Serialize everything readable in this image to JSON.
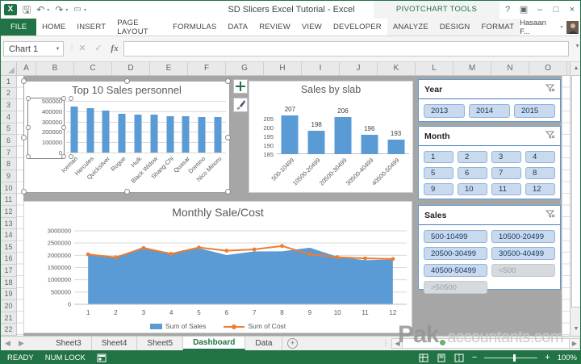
{
  "window": {
    "title": "SD Slicers Excel Tutorial - Excel",
    "contextual_title": "PIVOTCHART TOOLS",
    "controls": {
      "help": "?",
      "ribbon_display": "▣",
      "minimize": "–",
      "maximize": "□",
      "close": "×"
    }
  },
  "qat_icons": [
    "excel-logo",
    "save-icon",
    "undo-icon",
    "redo-icon",
    "touch-mode-icon",
    "customize-qat-icon"
  ],
  "ribbon": {
    "file_label": "FILE",
    "tabs": [
      "HOME",
      "INSERT",
      "PAGE LAYOUT",
      "FORMULAS",
      "DATA",
      "REVIEW",
      "VIEW",
      "DEVELOPER"
    ],
    "contextual_tabs": [
      "ANALYZE",
      "DESIGN",
      "FORMAT"
    ],
    "user_name": "Hasaan F..."
  },
  "formula_bar": {
    "name_box": "Chart 1",
    "formula": ""
  },
  "grid": {
    "columns": [
      "A",
      "B",
      "C",
      "D",
      "E",
      "F",
      "G",
      "H",
      "I",
      "J",
      "K",
      "L",
      "M",
      "N",
      "O"
    ],
    "rows": [
      "1",
      "2",
      "3",
      "4",
      "5",
      "6",
      "7",
      "8",
      "9",
      "10",
      "11",
      "12",
      "13",
      "14",
      "15",
      "16",
      "17",
      "18",
      "19",
      "20",
      "21",
      "22"
    ]
  },
  "chart_data": [
    {
      "type": "bar",
      "title": "Top 10 Sales personnel",
      "categories": [
        "Iceman",
        "Hercules",
        "Quicksilver",
        "Rogue",
        "Hulk",
        "Black Widow",
        "Shang-Chi",
        "Quasar",
        "Domino",
        "Nico Minoru"
      ],
      "values": [
        445000,
        433000,
        407000,
        372000,
        371000,
        370000,
        355000,
        353000,
        347000,
        346000
      ],
      "ylim": [
        0,
        500000
      ],
      "yticks": [
        0,
        100000,
        200000,
        300000,
        400000,
        500000
      ],
      "bar_color": "#5b9bd5",
      "grid": true,
      "selected": true
    },
    {
      "type": "bar",
      "title": "Sales by slab",
      "categories": [
        "500-10499",
        "10500-20499",
        "20500-30499",
        "30500-40499",
        "40500-50499"
      ],
      "values": [
        207,
        198,
        206,
        196,
        193
      ],
      "data_labels": [
        207,
        198,
        206,
        196,
        193
      ],
      "ylim": [
        185,
        210
      ],
      "yticks": [
        185,
        190,
        195,
        200,
        205
      ],
      "bar_color": "#5b9bd5",
      "grid": false
    },
    {
      "type": "area-line",
      "title": "Monthly Sale/Cost",
      "x": [
        1,
        2,
        3,
        4,
        5,
        6,
        7,
        8,
        9,
        10,
        11,
        12
      ],
      "series": [
        {
          "name": "Sum of Sales",
          "type": "area",
          "color": "#5b9bd5",
          "values": [
            2010000,
            1915000,
            2345000,
            2040000,
            2290000,
            2010000,
            2160000,
            2165000,
            2310000,
            1940000,
            1800000,
            1830000
          ]
        },
        {
          "name": "Sum of Cost",
          "type": "line",
          "color": "#ed7d31",
          "values": [
            2040000,
            1915000,
            2300000,
            2060000,
            2320000,
            2190000,
            2240000,
            2380000,
            2040000,
            1925000,
            1875000,
            1850000
          ]
        }
      ],
      "ylim": [
        0,
        3000000
      ],
      "yticks": [
        0,
        500000,
        1000000,
        1500000,
        2000000,
        2500000,
        3000000
      ],
      "legend": "bottom"
    }
  ],
  "chart_buttons": [
    "add-chart-element",
    "chart-styles"
  ],
  "slicers": [
    {
      "title": "Year",
      "columns": 3,
      "items": [
        {
          "label": "2013",
          "state": "selected"
        },
        {
          "label": "2014",
          "state": "selected"
        },
        {
          "label": "2015",
          "state": "selected"
        }
      ]
    },
    {
      "title": "Month",
      "columns": 4,
      "items": [
        {
          "label": "1",
          "state": "selected"
        },
        {
          "label": "2",
          "state": "selected"
        },
        {
          "label": "3",
          "state": "selected"
        },
        {
          "label": "4",
          "state": "selected"
        },
        {
          "label": "5",
          "state": "selected"
        },
        {
          "label": "6",
          "state": "selected"
        },
        {
          "label": "7",
          "state": "selected"
        },
        {
          "label": "8",
          "state": "selected"
        },
        {
          "label": "9",
          "state": "selected"
        },
        {
          "label": "10",
          "state": "selected"
        },
        {
          "label": "11",
          "state": "selected"
        },
        {
          "label": "12",
          "state": "selected"
        }
      ]
    },
    {
      "title": "Sales",
      "columns": 2,
      "items": [
        {
          "label": "500-10499",
          "state": "selected"
        },
        {
          "label": "10500-20499",
          "state": "selected"
        },
        {
          "label": "20500-30499",
          "state": "selected"
        },
        {
          "label": "30500-40499",
          "state": "selected"
        },
        {
          "label": "40500-50499",
          "state": "selected"
        },
        {
          "label": "<500",
          "state": "nodata"
        },
        {
          "label": ">50500",
          "state": "nodata"
        }
      ]
    }
  ],
  "sheet_tabs": {
    "tabs": [
      "Sheet3",
      "Sheet4",
      "Sheet5",
      "Dashboard",
      "Data"
    ],
    "active": "Dashboard"
  },
  "status_bar": {
    "mode": "READY",
    "numlock": "NUM LOCK",
    "zoom": "100%"
  },
  "watermark": {
    "bold": "Pak",
    "rest": "accountants.com"
  },
  "colors": {
    "excel_green": "#217346",
    "bar_blue": "#5b9bd5",
    "line_orange": "#ed7d31",
    "dashboard_gray": "#a6a6a6",
    "slicer_selected": "#c9d9ee"
  }
}
